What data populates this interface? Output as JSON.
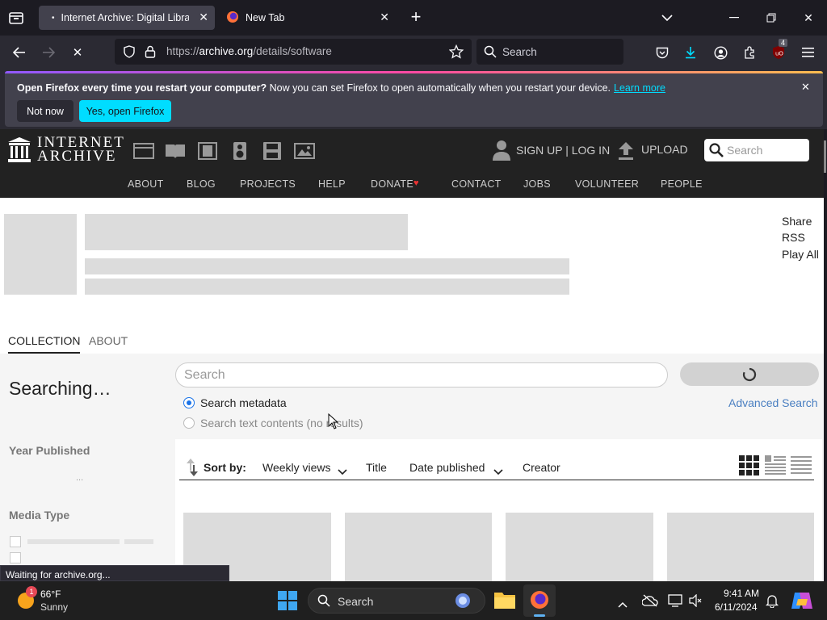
{
  "browser": {
    "tabs": [
      {
        "title": "Internet Archive: Digital Library",
        "active": true
      },
      {
        "title": "New Tab",
        "active": false
      }
    ],
    "url_prefix": "https://",
    "url_domain": "archive.org",
    "url_path": "/details/software",
    "search_placeholder": "Search",
    "extension_badge": "4"
  },
  "notification": {
    "bold": "Open Firefox every time you restart your computer?",
    "message": " Now you can set Firefox to open automatically when you restart your device.",
    "link": "Learn more",
    "not_now": "Not now",
    "yes_open": "Yes, open Firefox"
  },
  "ia": {
    "logo_line1": "INTERNET",
    "logo_line2": "ARCHIVE",
    "signup": "SIGN UP | LOG IN",
    "upload": "UPLOAD",
    "search_placeholder": "Search",
    "nav": [
      "ABOUT",
      "BLOG",
      "PROJECTS",
      "HELP",
      "DONATE",
      "CONTACT",
      "JOBS",
      "VOLUNTEER",
      "PEOPLE"
    ]
  },
  "page": {
    "share": "Share",
    "rss": "RSS",
    "play_all": "Play All",
    "tab_collection": "COLLECTION",
    "tab_about": "ABOUT",
    "searching": "Searching…",
    "search_placeholder": "Search",
    "search_metadata": "Search metadata",
    "search_text": "Search text contents (no results)",
    "advanced_search": "Advanced Search",
    "year_published": "Year Published",
    "year_dots": "...",
    "media_type": "Media Type",
    "sort_by": "Sort by:",
    "sort_options": [
      "Weekly views",
      "Title",
      "Date published",
      "Creator"
    ]
  },
  "status_text": "Waiting for archive.org...",
  "taskbar": {
    "weather_temp": "66°F",
    "weather_desc": "Sunny",
    "weather_badge": "1",
    "search": "Search",
    "time": "9:41 AM",
    "date": "6/11/2024"
  },
  "colors": {
    "firefox_dark": "#1c1b22",
    "ia_header": "#222222",
    "accent_cyan": "#00ddff",
    "link_blue": "#4a7fc1",
    "skeleton": "#dcdcdc"
  }
}
